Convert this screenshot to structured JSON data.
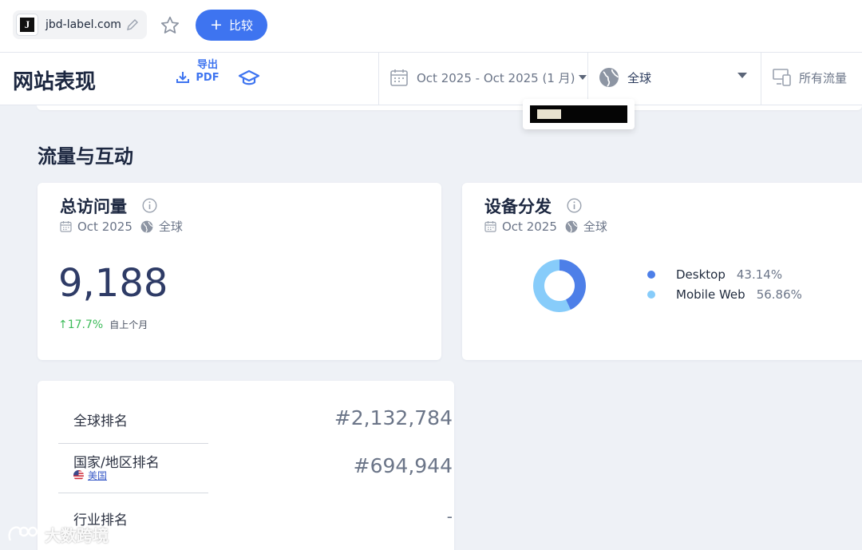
{
  "topbar": {
    "site_name": "jbd-label.com",
    "site_logo_letter": "J",
    "compare_label": "比较"
  },
  "subbar": {
    "page_title": "网站表现",
    "export_label": "导出 PDF",
    "date_range": "Oct 2025 - Oct 2025 (1 月)",
    "region": "全球",
    "traffic_type": "所有流量"
  },
  "section": {
    "title": "流量与互动"
  },
  "visits_card": {
    "title": "总访问量",
    "date": "Oct 2025",
    "region": "全球",
    "value": "9,188",
    "change_pct": "17.7%",
    "change_label": "自上个月",
    "change_direction": "up"
  },
  "device_card": {
    "title": "设备分发",
    "date": "Oct 2025",
    "region": "全球",
    "chart_data": {
      "type": "pie",
      "categories": [
        "Desktop",
        "Mobile Web"
      ],
      "values": [
        43.14,
        56.86
      ],
      "labels": [
        "43.14%",
        "56.86%"
      ],
      "colors": [
        "#4d7fe8",
        "#87ccfa"
      ],
      "legend": "right"
    }
  },
  "ranks": [
    {
      "label": "全球排名",
      "value": "#2,132,784"
    },
    {
      "label": "国家/地区排名",
      "value": "#694,944",
      "country": "美国"
    },
    {
      "label": "行业排名",
      "value": "-"
    }
  ],
  "watermark": "大数跨境",
  "colors": {
    "accent": "#3e74f0",
    "positive": "#3dbb5a",
    "desktop": "#4d7fe8",
    "mobile": "#87ccfa"
  }
}
